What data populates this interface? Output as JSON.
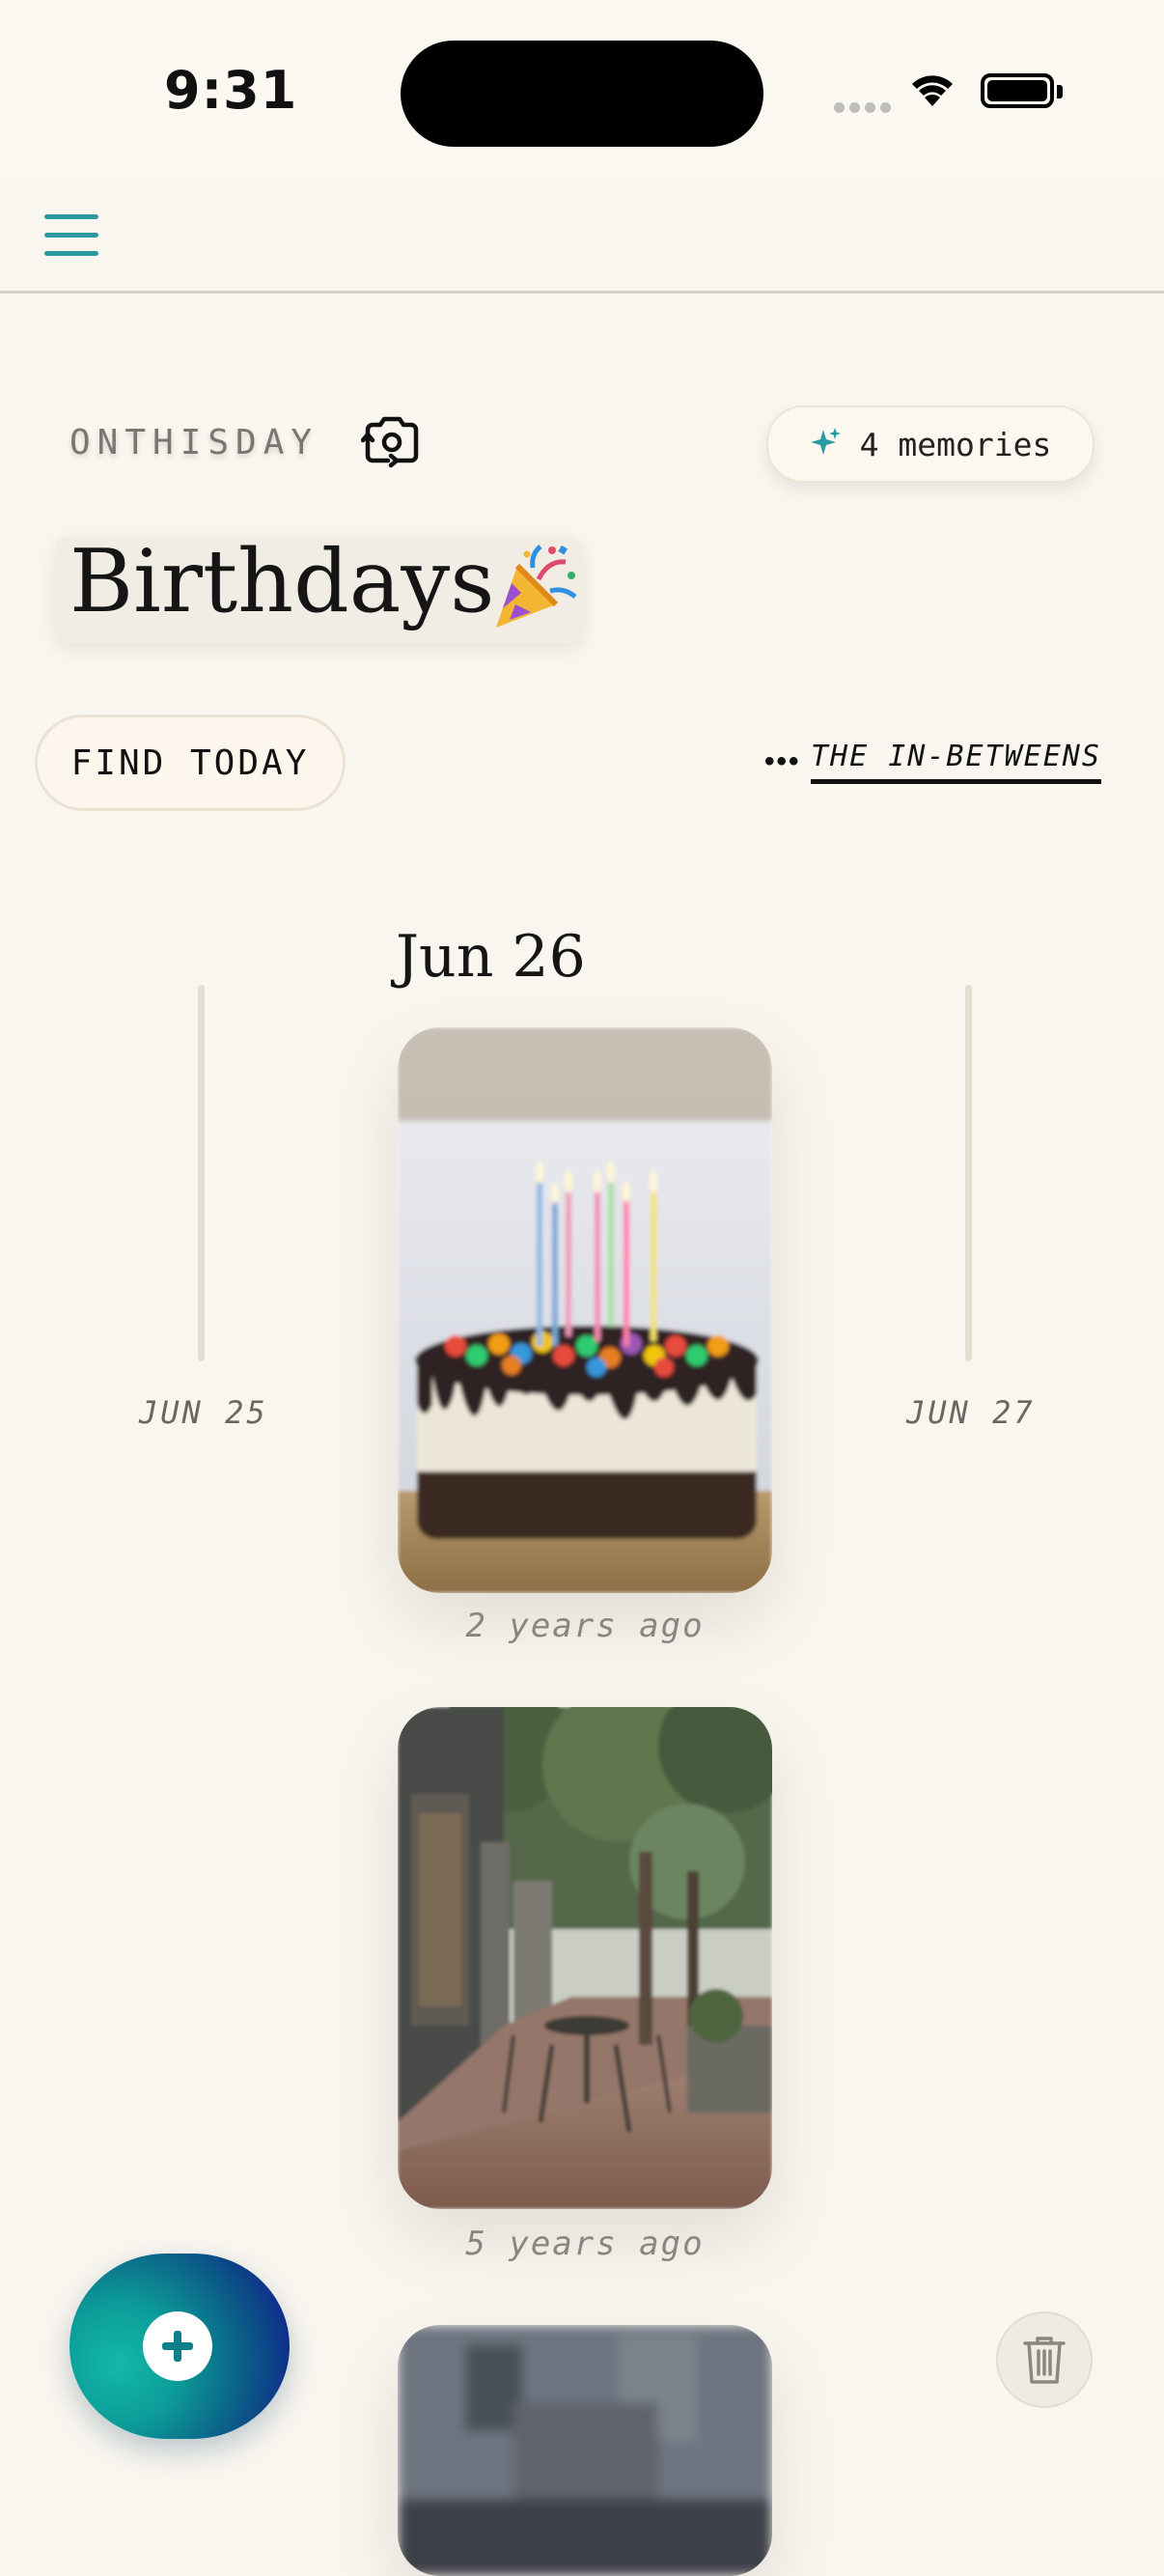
{
  "status_bar": {
    "time": "9:31"
  },
  "header": {
    "menu_icon": "hamburger-menu-icon"
  },
  "brand": {
    "name": "ONTHISDAY",
    "switch_icon": "camera-switch-icon"
  },
  "memories_pill": {
    "icon": "sparkle-icon",
    "label": "4 memories"
  },
  "page": {
    "title": "Birthdays",
    "title_emoji": "party-popper-icon"
  },
  "actions": {
    "find_today": "FIND TODAY",
    "dots": "•••",
    "in_betweens": "THE IN-BETWEENS"
  },
  "timeline": {
    "current_date": "Jun 26",
    "prev_date": "JUN 25",
    "next_date": "JUN 27",
    "memories": [
      {
        "photo": "birthday-cake-photo",
        "ago": "2 years ago"
      },
      {
        "photo": "street-cafe-photo",
        "ago": "5 years ago"
      },
      {
        "photo": "blurred-room-photo",
        "ago": ""
      }
    ]
  },
  "fab": {
    "icon": "plus-icon"
  },
  "trash": {
    "icon": "trash-icon"
  },
  "colors": {
    "accent": "#2a9aa0",
    "background": "#f9f6f0"
  }
}
